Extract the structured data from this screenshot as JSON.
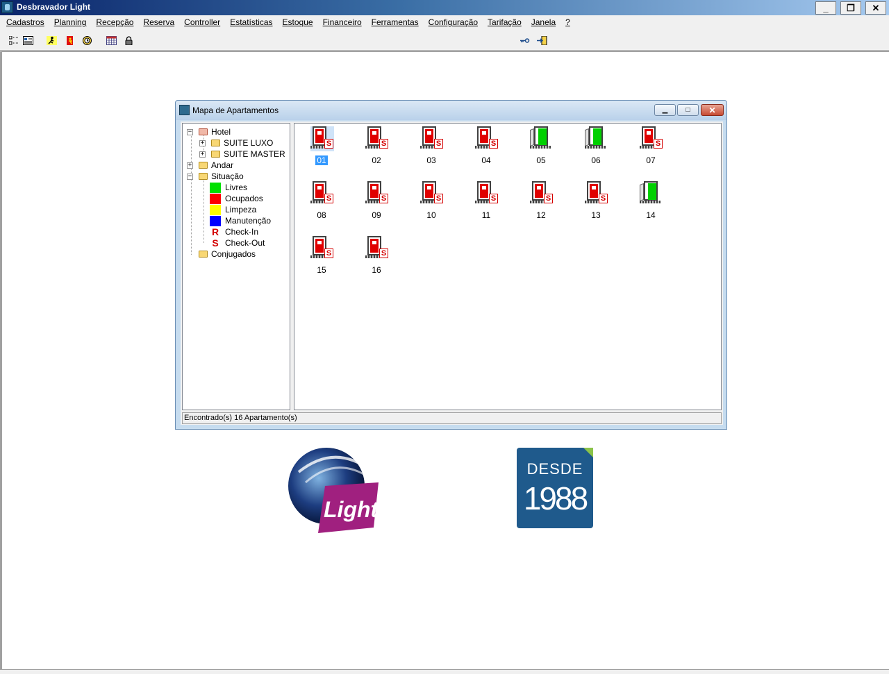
{
  "window": {
    "title": "Desbravador Light"
  },
  "menu": [
    "Cadastros",
    "Planning",
    "Recepção",
    "Reserva",
    "Controller",
    "Estatísticas",
    "Estoque",
    "Financeiro",
    "Ferramentas",
    "Configuração",
    "Tarifação",
    "Janela",
    "?"
  ],
  "toolbar": {
    "left_icons": [
      "tree-view-icon",
      "form-icon",
      "runner-icon",
      "door-exit-icon",
      "clock-icon",
      "calendar-icon",
      "lock-icon"
    ],
    "right_icons": [
      "key-icon",
      "exit-door-icon"
    ]
  },
  "child": {
    "title": "Mapa de Apartamentos",
    "tree": {
      "root": "Hotel",
      "types": [
        "SUITE LUXO",
        "SUITE MASTER"
      ],
      "andar": "Andar",
      "situacao": "Situação",
      "legend": [
        {
          "label": "Livres",
          "color": "#00e000"
        },
        {
          "label": "Ocupados",
          "color": "#ff0000"
        },
        {
          "label": "Limpeza",
          "color": "#ffff00"
        },
        {
          "label": "Manutenção",
          "color": "#0000ff"
        },
        {
          "label": "Check-In",
          "glyph": "R"
        },
        {
          "label": "Check-Out",
          "glyph": "S"
        }
      ],
      "conjugados": "Conjugados"
    },
    "apartments": [
      {
        "num": "01",
        "status": "occupied",
        "selected": true
      },
      {
        "num": "02",
        "status": "occupied"
      },
      {
        "num": "03",
        "status": "occupied"
      },
      {
        "num": "04",
        "status": "occupied"
      },
      {
        "num": "05",
        "status": "free"
      },
      {
        "num": "06",
        "status": "free"
      },
      {
        "num": "07",
        "status": "occupied"
      },
      {
        "num": "08",
        "status": "occupied"
      },
      {
        "num": "09",
        "status": "occupied"
      },
      {
        "num": "10",
        "status": "occupied"
      },
      {
        "num": "11",
        "status": "occupied"
      },
      {
        "num": "12",
        "status": "occupied"
      },
      {
        "num": "13",
        "status": "occupied"
      },
      {
        "num": "14",
        "status": "free"
      },
      {
        "num": "15",
        "status": "occupied"
      },
      {
        "num": "16",
        "status": "occupied"
      }
    ],
    "status_text": "Encontrado(s) 16  Apartamento(s)"
  },
  "logos": {
    "light": "Light",
    "desde": "DESDE",
    "year": "1988"
  }
}
